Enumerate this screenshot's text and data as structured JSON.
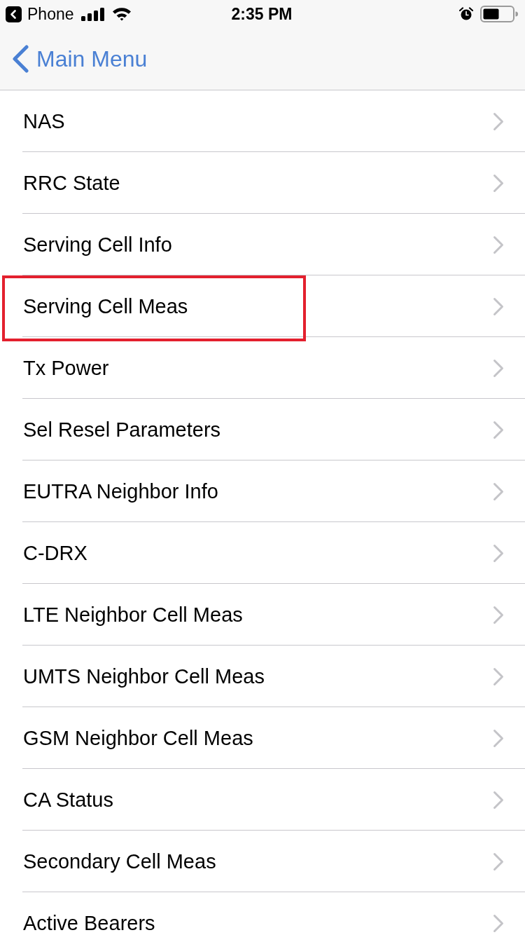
{
  "status_bar": {
    "back_label": "Phone",
    "time": "2:35 PM"
  },
  "nav_bar": {
    "back_button": "Main Menu"
  },
  "rows": [
    {
      "label": "NAS",
      "highlighted": false
    },
    {
      "label": "RRC State",
      "highlighted": false
    },
    {
      "label": "Serving Cell Info",
      "highlighted": false
    },
    {
      "label": "Serving Cell Meas",
      "highlighted": true
    },
    {
      "label": "Tx Power",
      "highlighted": false
    },
    {
      "label": "Sel Resel Parameters",
      "highlighted": false
    },
    {
      "label": "EUTRA Neighbor Info",
      "highlighted": false
    },
    {
      "label": "C-DRX",
      "highlighted": false
    },
    {
      "label": "LTE Neighbor Cell Meas",
      "highlighted": false
    },
    {
      "label": "UMTS Neighbor Cell Meas",
      "highlighted": false
    },
    {
      "label": "GSM Neighbor Cell Meas",
      "highlighted": false
    },
    {
      "label": "CA Status",
      "highlighted": false
    },
    {
      "label": "Secondary Cell Meas",
      "highlighted": false
    },
    {
      "label": "Active Bearers",
      "highlighted": false
    }
  ]
}
